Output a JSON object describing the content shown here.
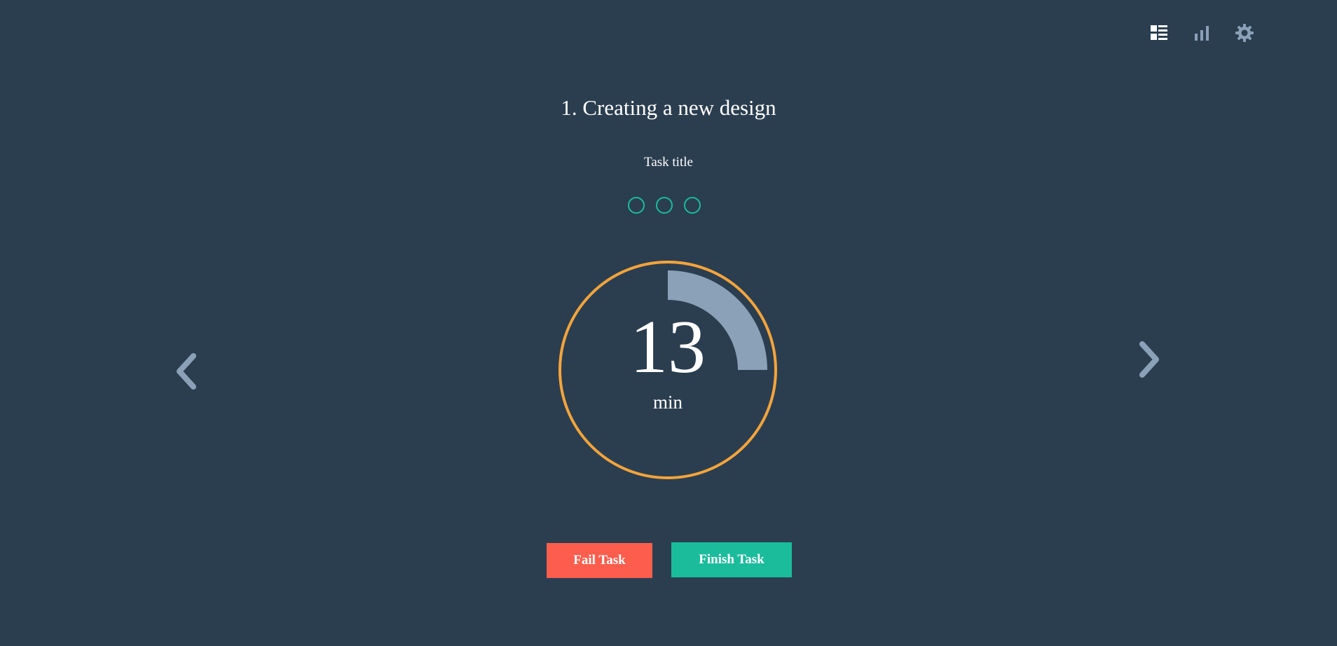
{
  "toolbar": {
    "icons": [
      "list-icon",
      "bar-chart-icon",
      "gear-icon"
    ],
    "active_color": "#ffffff",
    "inactive_color": "#8aa1b7"
  },
  "task": {
    "heading": "1. Creating a new design",
    "subtitle": "Task title",
    "dot_count": 3
  },
  "timer": {
    "value": "13",
    "unit": "min",
    "progress_fraction": 0.25,
    "ring_color": "#f5a43b",
    "progress_color": "#8aa1b7"
  },
  "navigation": {
    "prev_icon": "chevron-left-icon",
    "next_icon": "chevron-right-icon"
  },
  "actions": {
    "fail_label": "Fail Task",
    "finish_label": "Finish Task",
    "fail_color": "#fc5d4d",
    "finish_color": "#1abc9c"
  },
  "colors": {
    "background": "#2b3e50",
    "accent": "#1abc9c"
  }
}
